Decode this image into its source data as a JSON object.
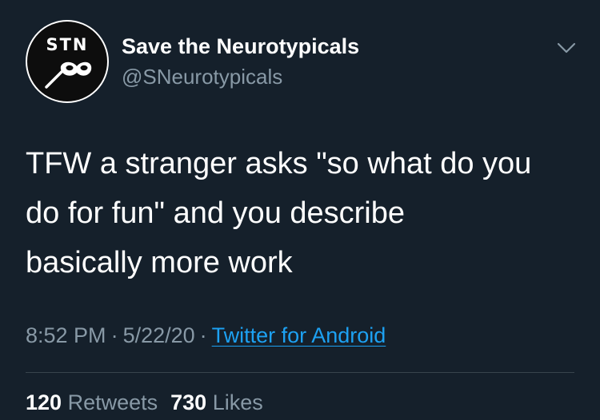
{
  "tweet": {
    "avatar": {
      "text": "STN",
      "icon": "mask-icon"
    },
    "display_name": "Save the Neurotypicals",
    "handle": "@SNeurotypicals",
    "more_icon": "chevron-down-icon",
    "text_lines": [
      "TFW a stranger asks \"so what do you",
      "do for fun\" and you describe",
      "basically more work"
    ],
    "time": "8:52 PM",
    "separator": "·",
    "date": "5/22/20",
    "source": "Twitter for Android",
    "retweets": {
      "count": "120",
      "label": "Retweets"
    },
    "likes": {
      "count": "730",
      "label": "Likes"
    }
  },
  "colors": {
    "background": "#15202b",
    "text_primary": "#ffffff",
    "text_secondary": "#8899a6",
    "link": "#1da1f2",
    "divider": "#38444d"
  }
}
